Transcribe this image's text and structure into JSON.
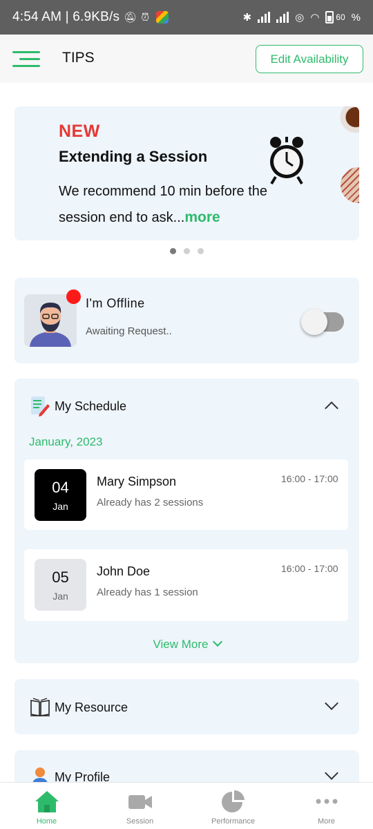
{
  "status_bar": {
    "time_text": "4:54 AM | 6.9KB/s",
    "battery": "60"
  },
  "header": {
    "title": "TIPS",
    "edit_availability_label": "Edit Availability"
  },
  "tip_banner": {
    "badge": "NEW",
    "title": "Extending a Session",
    "body": "We recommend 10 min before the session end to ask...",
    "more_label": "more",
    "page_count": 3,
    "active_page": 1
  },
  "availability": {
    "title": "I'm Offline",
    "subtitle": "Awaiting Request..",
    "online": false
  },
  "schedule": {
    "title": "My Schedule",
    "month": "January, 2023",
    "items": [
      {
        "day": "04",
        "month": "Jan",
        "name": "Mary Simpson",
        "detail": "Already has 2 sessions",
        "time": "16:00 - 17:00"
      },
      {
        "day": "05",
        "month": "Jan",
        "name": "John Doe",
        "detail": "Already has 1 session",
        "time": "16:00 - 17:00"
      }
    ],
    "view_more_label": "View More"
  },
  "resource": {
    "title": "My Resource"
  },
  "profile": {
    "title": "My Profile"
  },
  "bottom_nav": {
    "items": [
      {
        "label": "Home",
        "icon": "home-icon",
        "active": true
      },
      {
        "label": "Session",
        "icon": "video-camera-icon",
        "active": false
      },
      {
        "label": "Performance",
        "icon": "pie-chart-icon",
        "active": false
      },
      {
        "label": "More",
        "icon": "more-dots-icon",
        "active": false
      }
    ]
  },
  "colors": {
    "accent": "#2dbb6b",
    "badge_red": "#e53935",
    "card_bg": "#eef5fb",
    "status_bar": "#5f5f5f"
  }
}
